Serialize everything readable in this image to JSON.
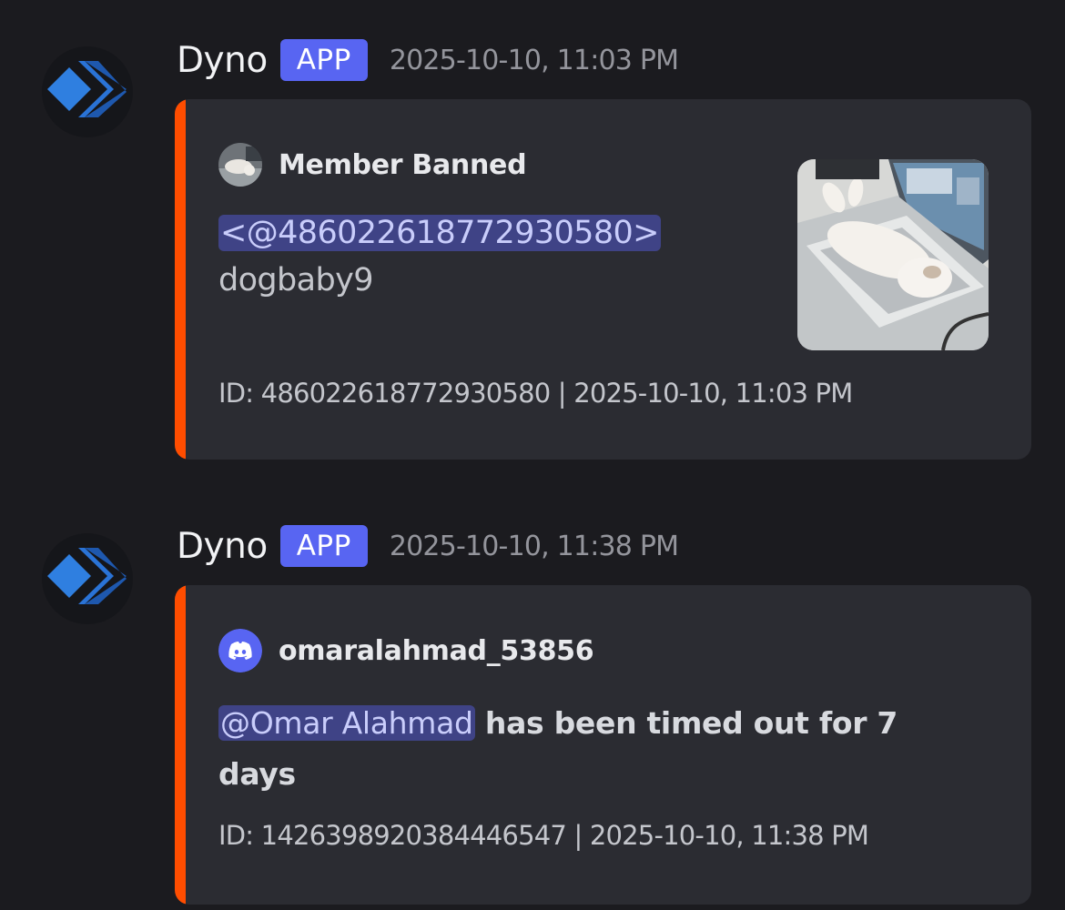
{
  "messages": [
    {
      "username": "Dyno",
      "badge": "APP",
      "timestamp": "2025-10-10, 11:03 PM",
      "embed": {
        "author": "Member Banned",
        "mention": "<@486022618772930580>",
        "subtext": "dogbaby9",
        "footer": "ID: 486022618772930580 | 2025-10-10, 11:03 PM",
        "thumbnail_icon": "cat-on-laptop-photo"
      }
    },
    {
      "username": "Dyno",
      "badge": "APP",
      "timestamp": "2025-10-10, 11:38 PM",
      "embed": {
        "author": "omaralahmad_53856",
        "mention": "@Omar Alahmad",
        "text_part1": " has been timed out for 7",
        "text_part2": "days",
        "footer": "ID: 1426398920384446547 | 2025-10-10, 11:38 PM",
        "author_icon": "discord-logo-icon"
      }
    }
  ],
  "colors": {
    "background": "#1b1b1f",
    "embed_background": "#2b2c32",
    "embed_accent": "#ff4d00",
    "badge": "#5865f2",
    "mention_bg": "#3f4386",
    "mention_text": "#c9cdfb",
    "discord_blurple": "#5865f2",
    "dyno_blue": "#2f7fe0"
  }
}
